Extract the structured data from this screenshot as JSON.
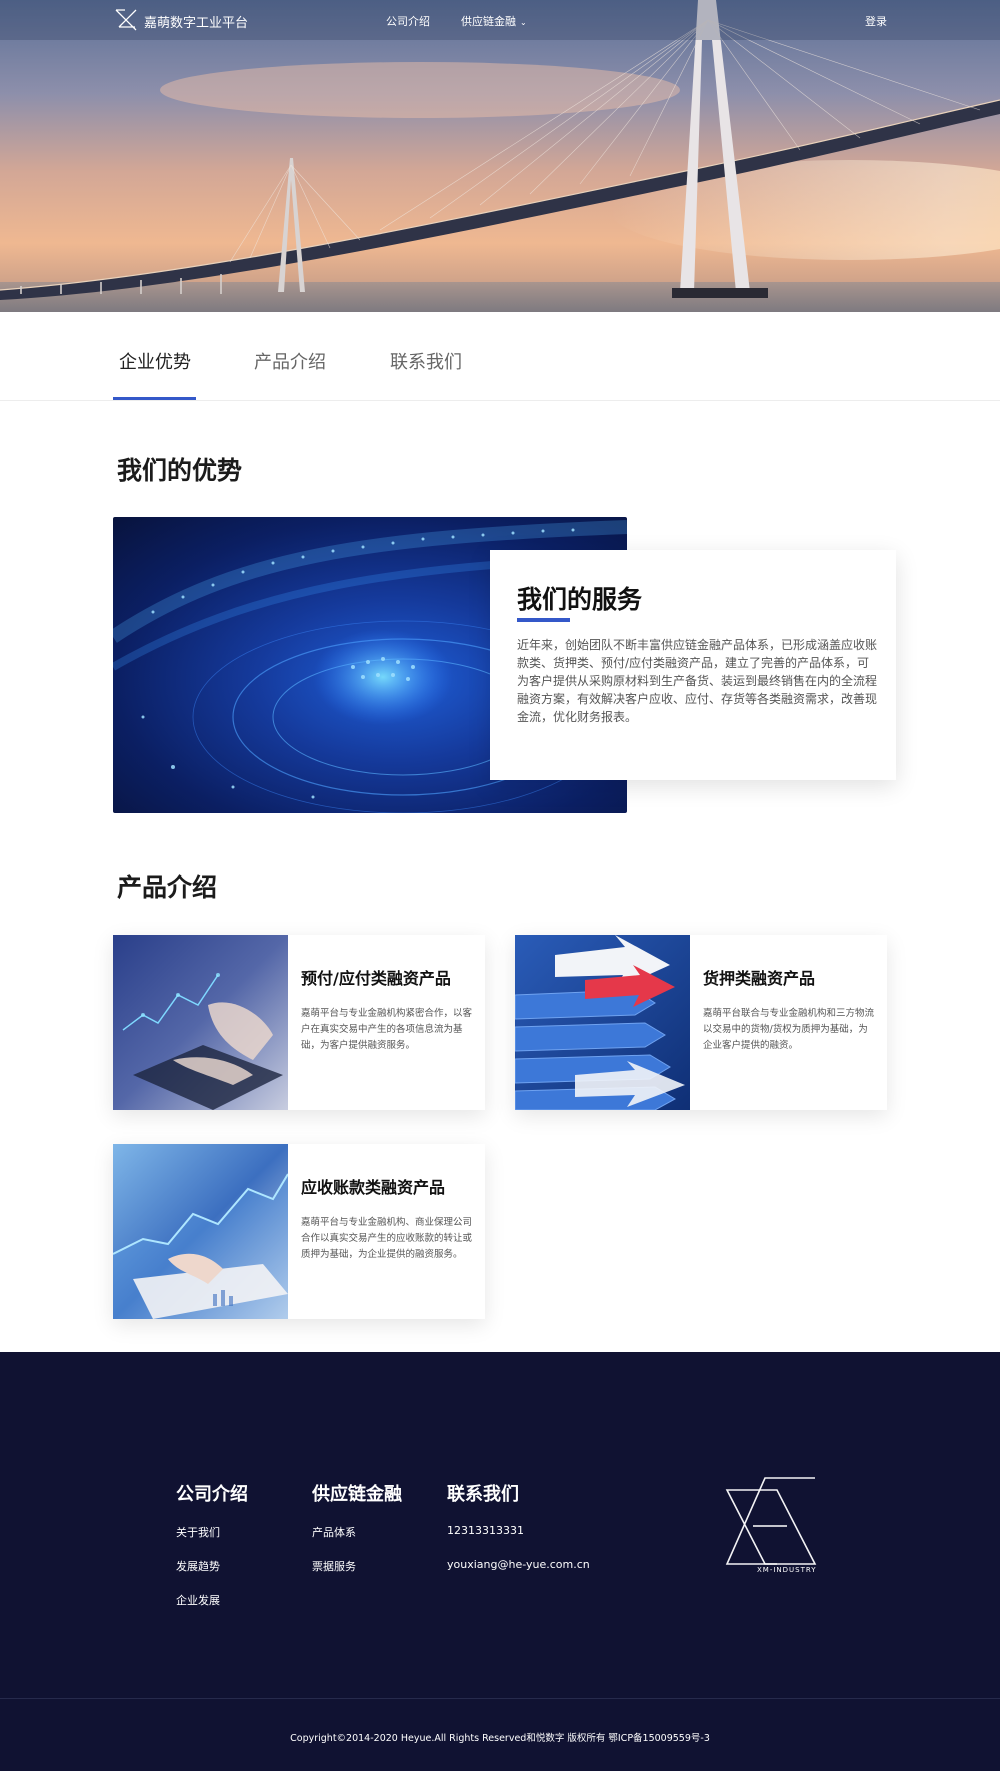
{
  "header": {
    "brand": "嘉萌数字工业平台",
    "nav": {
      "company": "公司介绍",
      "finance": "供应链金融",
      "login": "登录"
    }
  },
  "tabs": [
    {
      "label": "企业优势",
      "active": true
    },
    {
      "label": "产品介绍",
      "active": false
    },
    {
      "label": "联系我们",
      "active": false
    }
  ],
  "advantages": {
    "title": "我们的优势",
    "service": {
      "title": "我们的服务",
      "text": "近年来，创始团队不断丰富供应链金融产品体系，已形成涵盖应收账款类、货押类、预付/应付类融资产品，建立了完善的产品体系，可为客户提供从采购原材料到生产备货、装运到最终销售在内的全流程融资方案，有效解决客户应收、应付、存货等各类融资需求，改善现金流，优化财务报表。"
    }
  },
  "products": {
    "title": "产品介绍",
    "items": [
      {
        "name": "预付/应付类融资产品",
        "desc": "嘉萌平台与专业金融机构紧密合作，以客户在真实交易中产生的各项信息流为基础，为客户提供融资服务。"
      },
      {
        "name": "货押类融资产品",
        "desc": "嘉萌平台联合与专业金融机构和三方物流以交易中的货物/货权为质押为基础，为企业客户提供的融资。"
      },
      {
        "name": "应收账款类融资产品",
        "desc": "嘉萌平台与专业金融机构、商业保理公司合作以真实交易产生的应收账款的转让或质押为基础，为企业提供的融资服务。"
      }
    ]
  },
  "footer": {
    "columns": [
      {
        "title": "公司介绍",
        "links": [
          "关于我们",
          "发展趋势",
          "企业发展"
        ]
      },
      {
        "title": "供应链金融",
        "links": [
          "产品体系",
          "票据服务"
        ]
      },
      {
        "title": "联系我们",
        "links": [
          "12313313331",
          "youxiang@he-yue.com.cn"
        ]
      }
    ],
    "logo_text": "XM-INDUSTRY",
    "copyright": "Copyright©2014-2020 Heyue.All Rights Reserved和悦数字 版权所有 鄂ICP备15009559号-3"
  },
  "icons": {
    "logo": "x-logo-icon",
    "dropdown": "chevron-down-icon"
  },
  "colors": {
    "accent": "#3458c9",
    "footer_bg": "#101232"
  }
}
